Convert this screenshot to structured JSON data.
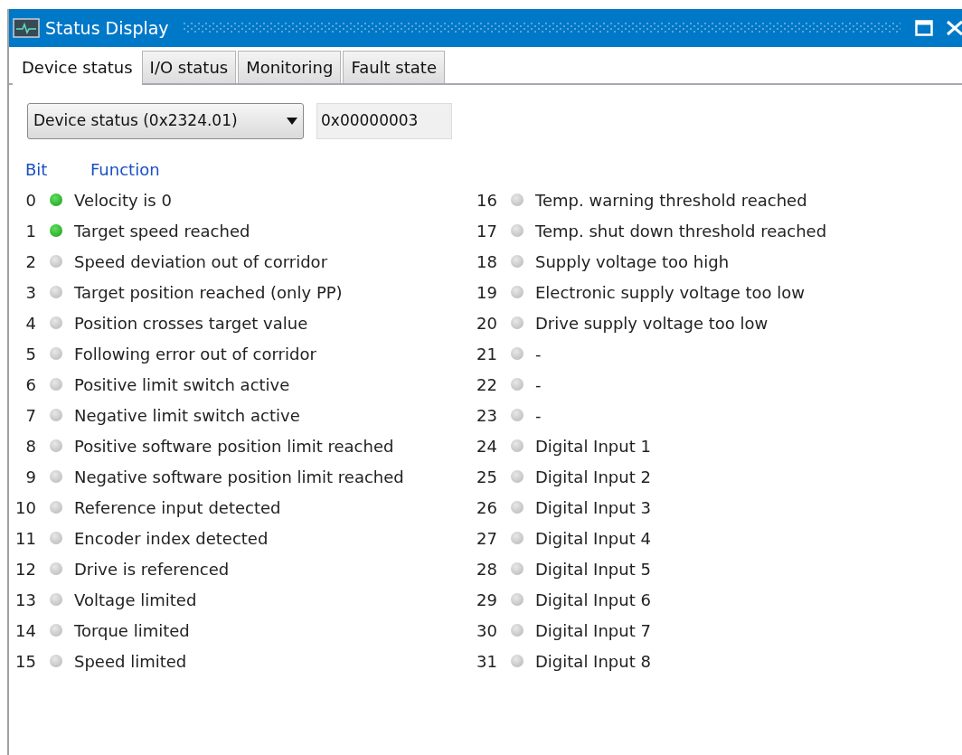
{
  "window": {
    "title": "Status Display"
  },
  "tabs": [
    {
      "label": "Device status",
      "selected": true
    },
    {
      "label": "I/O status",
      "selected": false
    },
    {
      "label": "Monitoring",
      "selected": false
    },
    {
      "label": "Fault state",
      "selected": false
    }
  ],
  "selector": {
    "value": "Device status (0x2324.01)"
  },
  "hex_value": "0x00000003",
  "columns": [
    "Bit",
    "Function"
  ],
  "bits": [
    {
      "bit": "0",
      "function": "Velocity is 0",
      "on": true
    },
    {
      "bit": "1",
      "function": "Target speed reached",
      "on": true
    },
    {
      "bit": "2",
      "function": "Speed deviation out of corridor",
      "on": false
    },
    {
      "bit": "3",
      "function": "Target position reached (only PP)",
      "on": false
    },
    {
      "bit": "4",
      "function": "Position crosses target value",
      "on": false
    },
    {
      "bit": "5",
      "function": "Following error out of corridor",
      "on": false
    },
    {
      "bit": "6",
      "function": "Positive limit switch active",
      "on": false
    },
    {
      "bit": "7",
      "function": "Negative limit switch active",
      "on": false
    },
    {
      "bit": "8",
      "function": "Positive software position limit reached",
      "on": false
    },
    {
      "bit": "9",
      "function": "Negative software position limit reached",
      "on": false
    },
    {
      "bit": "10",
      "function": "Reference input detected",
      "on": false
    },
    {
      "bit": "11",
      "function": "Encoder index detected",
      "on": false
    },
    {
      "bit": "12",
      "function": "Drive is referenced",
      "on": false
    },
    {
      "bit": "13",
      "function": "Voltage limited",
      "on": false
    },
    {
      "bit": "14",
      "function": "Torque limited",
      "on": false
    },
    {
      "bit": "15",
      "function": "Speed limited",
      "on": false
    },
    {
      "bit": "16",
      "function": "Temp. warning threshold reached",
      "on": false
    },
    {
      "bit": "17",
      "function": "Temp. shut down threshold reached",
      "on": false
    },
    {
      "bit": "18",
      "function": "Supply voltage too high",
      "on": false
    },
    {
      "bit": "19",
      "function": "Electronic supply voltage too low",
      "on": false
    },
    {
      "bit": "20",
      "function": "Drive supply voltage too low",
      "on": false
    },
    {
      "bit": "21",
      "function": "-",
      "on": false
    },
    {
      "bit": "22",
      "function": "-",
      "on": false
    },
    {
      "bit": "23",
      "function": "-",
      "on": false
    },
    {
      "bit": "24",
      "function": "Digital Input 1",
      "on": false
    },
    {
      "bit": "25",
      "function": "Digital Input 2",
      "on": false
    },
    {
      "bit": "26",
      "function": "Digital Input 3",
      "on": false
    },
    {
      "bit": "27",
      "function": "Digital Input 4",
      "on": false
    },
    {
      "bit": "28",
      "function": "Digital Input 5",
      "on": false
    },
    {
      "bit": "29",
      "function": "Digital Input 6",
      "on": false
    },
    {
      "bit": "30",
      "function": "Digital Input 7",
      "on": false
    },
    {
      "bit": "31",
      "function": "Digital Input 8",
      "on": false
    }
  ]
}
